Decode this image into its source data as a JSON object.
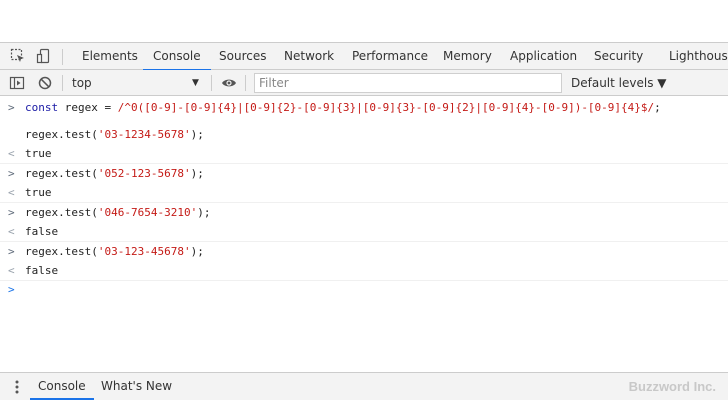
{
  "devtools": {
    "tabs": [
      {
        "label": "Elements",
        "active": false
      },
      {
        "label": "Console",
        "active": true
      },
      {
        "label": "Sources",
        "active": false
      },
      {
        "label": "Network",
        "active": false
      },
      {
        "label": "Performance",
        "active": false
      },
      {
        "label": "Memory",
        "active": false
      },
      {
        "label": "Application",
        "active": false
      },
      {
        "label": "Security",
        "active": false
      },
      {
        "label": "Lighthouse",
        "active": false
      }
    ],
    "icons": [
      "inspect-element-icon",
      "device-toolbar-icon"
    ]
  },
  "toolbar": {
    "context": "top",
    "filter_placeholder": "Filter",
    "levels": "Default levels ▼",
    "icons": [
      "sidebar-toggle-icon",
      "clear-console-icon",
      "eye-icon"
    ]
  },
  "console": {
    "entries": [
      {
        "type": "input",
        "parts": [
          [
            "kw",
            "const "
          ],
          [
            "plain",
            "regex = "
          ],
          [
            "str",
            "/^0([0-9]-[0-9]{4}|[0-9]{2}-[0-9]{3}|[0-9]{3}-[0-9]{2}|[0-9]{4}-[0-9])-[0-9]{4}$/"
          ],
          [
            "plain",
            ";"
          ]
        ]
      },
      {
        "type": "input-cont",
        "parts": [
          [
            "plain",
            "regex.test("
          ],
          [
            "str",
            "'03-1234-5678'"
          ],
          [
            "plain",
            ");"
          ]
        ]
      },
      {
        "type": "result",
        "text": "true"
      },
      {
        "type": "input",
        "parts": [
          [
            "plain",
            "regex.test("
          ],
          [
            "str",
            "'052-123-5678'"
          ],
          [
            "plain",
            ");"
          ]
        ]
      },
      {
        "type": "result",
        "text": "true"
      },
      {
        "type": "input",
        "parts": [
          [
            "plain",
            "regex.test("
          ],
          [
            "str",
            "'046-7654-3210'"
          ],
          [
            "plain",
            ");"
          ]
        ]
      },
      {
        "type": "result",
        "text": "false"
      },
      {
        "type": "input",
        "parts": [
          [
            "plain",
            "regex.test("
          ],
          [
            "str",
            "'03-123-45678'"
          ],
          [
            "plain",
            ");"
          ]
        ]
      },
      {
        "type": "result",
        "text": "false"
      }
    ],
    "prompt_marker": ">",
    "result_marker": "<"
  },
  "drawer": {
    "tabs": [
      {
        "label": "Console",
        "active": true
      },
      {
        "label": "What's New",
        "active": false
      }
    ],
    "brand": "Buzzword Inc."
  },
  "colors": {
    "accent": "#1a73e8",
    "string": "#c41a16",
    "keyword": "#1a1aa6",
    "result": "#1a1aa6"
  }
}
